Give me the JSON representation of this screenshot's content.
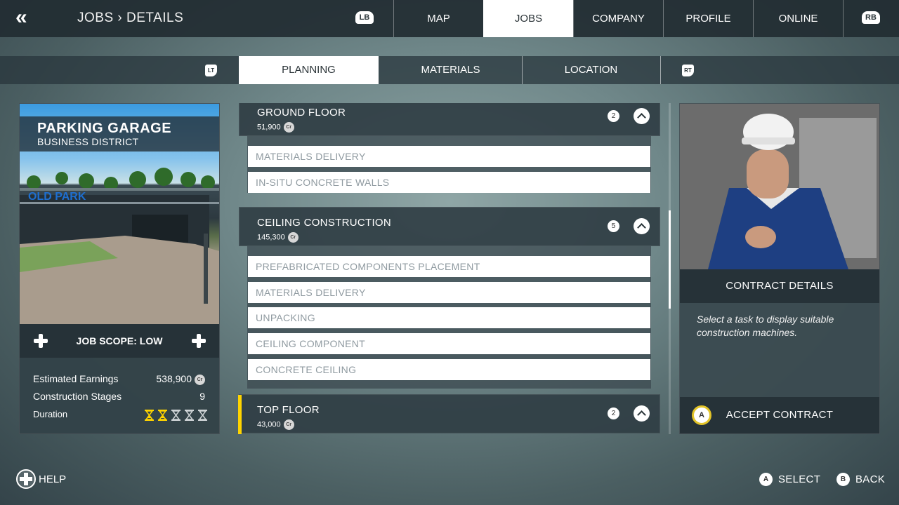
{
  "header": {
    "back_icon": "«",
    "breadcrumb": "JOBS › DETAILS",
    "lb": "LB",
    "rb": "RB",
    "tabs": [
      {
        "label": "MAP"
      },
      {
        "label": "JOBS",
        "active": true
      },
      {
        "label": "COMPANY"
      },
      {
        "label": "PROFILE"
      },
      {
        "label": "ONLINE"
      }
    ]
  },
  "subnav": {
    "lt": "LT",
    "rt": "RT",
    "tabs": [
      {
        "label": "PLANNING",
        "active": true
      },
      {
        "label": "MATERIALS"
      },
      {
        "label": "LOCATION"
      }
    ]
  },
  "job": {
    "title": "PARKING GARAGE",
    "subtitle": "BUSINESS DISTRICT",
    "sign_text": "OLD PARK",
    "scope_label": "JOB SCOPE: LOW",
    "stats": [
      {
        "label": "Estimated Earnings",
        "value": "538,900",
        "currency": "Cr"
      },
      {
        "label": "Construction Stages",
        "value": "9"
      }
    ],
    "duration_label": "Duration",
    "duration_filled": 2,
    "duration_total": 5,
    "accent_color": "#ffd400"
  },
  "stages": [
    {
      "name": "GROUND FLOOR",
      "price": "51,900",
      "currency": "Cr",
      "count": "2",
      "tasks": [
        "MATERIALS DELIVERY",
        "IN-SITU CONCRETE WALLS"
      ]
    },
    {
      "name": "CEILING CONSTRUCTION",
      "price": "145,300",
      "currency": "Cr",
      "count": "5",
      "tasks": [
        "PREFABRICATED COMPONENTS PLACEMENT",
        "MATERIALS DELIVERY",
        "UNPACKING",
        "CEILING COMPONENT",
        "CONCRETE CEILING"
      ]
    },
    {
      "name": "TOP FLOOR",
      "price": "43,000",
      "currency": "Cr",
      "count": "2",
      "tasks": [],
      "selected": true
    }
  ],
  "contract": {
    "heading": "CONTRACT DETAILS",
    "hint": "Select a task to display suitable construction machines.",
    "accept_button": "A",
    "accept_label": "ACCEPT CONTRACT"
  },
  "footer": {
    "help_label": "HELP",
    "select_button": "A",
    "select_label": "SELECT",
    "back_button": "B",
    "back_label": "BACK"
  }
}
